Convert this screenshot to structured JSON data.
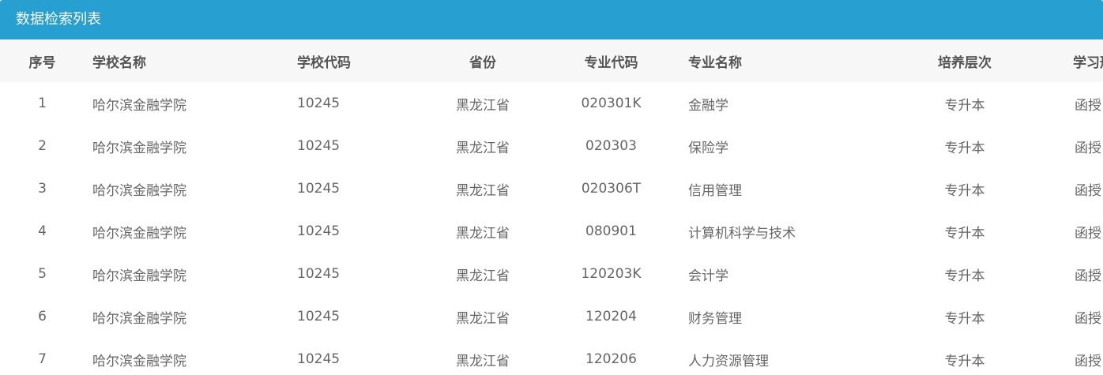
{
  "panel": {
    "title": "数据检索列表"
  },
  "table": {
    "headers": {
      "index": "序号",
      "school_name": "学校名称",
      "school_code": "学校代码",
      "province": "省份",
      "major_code": "专业代码",
      "major_name": "专业名称",
      "level": "培养层次",
      "study_mode": "学习形式"
    },
    "rows": [
      {
        "index": "1",
        "school_name": "哈尔滨金融学院",
        "school_code": "10245",
        "province": "黑龙江省",
        "major_code": "020301K",
        "major_name": "金融学",
        "level": "专升本",
        "study_mode": "函授"
      },
      {
        "index": "2",
        "school_name": "哈尔滨金融学院",
        "school_code": "10245",
        "province": "黑龙江省",
        "major_code": "020303",
        "major_name": "保险学",
        "level": "专升本",
        "study_mode": "函授"
      },
      {
        "index": "3",
        "school_name": "哈尔滨金融学院",
        "school_code": "10245",
        "province": "黑龙江省",
        "major_code": "020306T",
        "major_name": "信用管理",
        "level": "专升本",
        "study_mode": "函授"
      },
      {
        "index": "4",
        "school_name": "哈尔滨金融学院",
        "school_code": "10245",
        "province": "黑龙江省",
        "major_code": "080901",
        "major_name": "计算机科学与技术",
        "level": "专升本",
        "study_mode": "函授"
      },
      {
        "index": "5",
        "school_name": "哈尔滨金融学院",
        "school_code": "10245",
        "province": "黑龙江省",
        "major_code": "120203K",
        "major_name": "会计学",
        "level": "专升本",
        "study_mode": "函授"
      },
      {
        "index": "6",
        "school_name": "哈尔滨金融学院",
        "school_code": "10245",
        "province": "黑龙江省",
        "major_code": "120204",
        "major_name": "财务管理",
        "level": "专升本",
        "study_mode": "函授"
      },
      {
        "index": "7",
        "school_name": "哈尔滨金融学院",
        "school_code": "10245",
        "province": "黑龙江省",
        "major_code": "120206",
        "major_name": "人力资源管理",
        "level": "专升本",
        "study_mode": "函授"
      }
    ]
  },
  "colors": {
    "header_bar": "#279fd0",
    "table_header_bg": "#f7f7f7"
  }
}
